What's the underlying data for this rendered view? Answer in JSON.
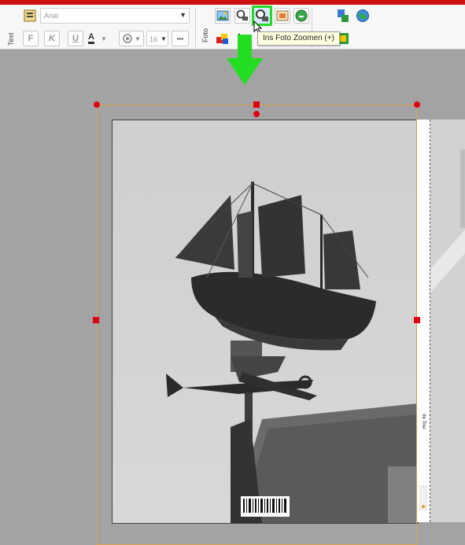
{
  "toolbar": {
    "text_section_label": "Text",
    "font_family_value": "Arial",
    "font_size_value": "16",
    "bold_label": "F",
    "italic_label": "K",
    "underline_label": "U",
    "text_color_label": "A",
    "more_label": "•••",
    "foto_section_label": "Foto"
  },
  "tooltip": {
    "text": "Ins Foto Zoomen (+)"
  },
  "canvas": {
    "spine_text": "Ihr Titel"
  },
  "colors": {
    "top_bar": "#cc0f12",
    "highlight": "#22dd22",
    "handle": "#e1000f",
    "selection_frame": "#d9a14e"
  }
}
